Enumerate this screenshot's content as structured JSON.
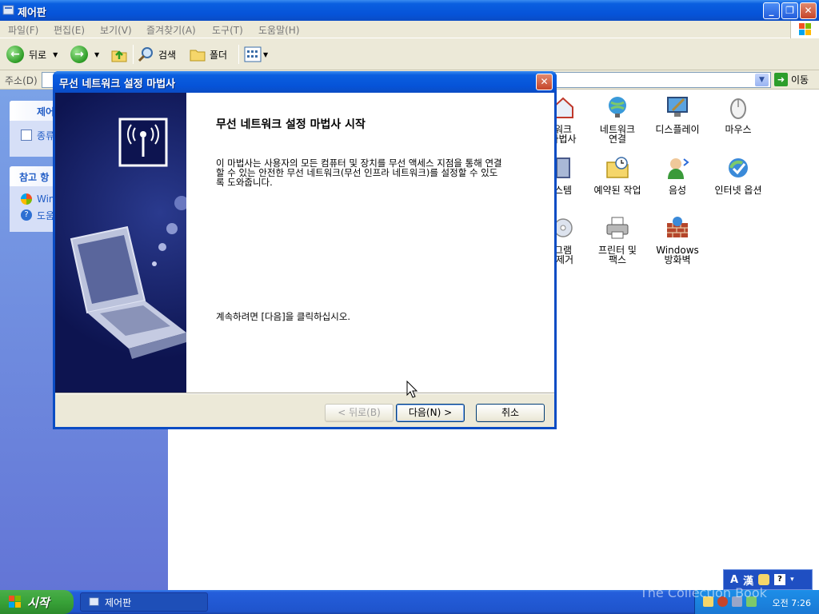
{
  "window": {
    "title": "제어판",
    "buttons": {
      "minimize": "_",
      "maximize": "❐",
      "close": "✕"
    }
  },
  "menubar": [
    "파일(F)",
    "편집(E)",
    "보기(V)",
    "즐겨찾기(A)",
    "도구(T)",
    "도움말(H)"
  ],
  "toolbar": {
    "back": "뒤로",
    "search": "검색",
    "folders": "폴더"
  },
  "addressbar": {
    "label": "주소(D)",
    "go": "이동"
  },
  "leftpane": {
    "panel1_title": "제어",
    "panel1_item": "종류",
    "panel2_title": "참고 항",
    "panel2_items": [
      "Win",
      "도움"
    ]
  },
  "content": {
    "icons": [
      {
        "name": "워크\n마법사",
        "icon": "network-wizard-icon"
      },
      {
        "name": "네트워크\n연결",
        "icon": "network-connections-icon"
      },
      {
        "name": "디스플레이",
        "icon": "display-icon"
      },
      {
        "name": "마우스",
        "icon": "mouse-icon"
      },
      {
        "name": "스템",
        "icon": "system-icon"
      },
      {
        "name": "예약된 작업",
        "icon": "scheduled-tasks-icon"
      },
      {
        "name": "음성",
        "icon": "speech-icon"
      },
      {
        "name": "인터넷 옵션",
        "icon": "internet-options-icon"
      },
      {
        "name": "그램\n/제거",
        "icon": "add-remove-programs-icon"
      },
      {
        "name": "프린터 및\n팩스",
        "icon": "printers-icon"
      },
      {
        "name": "Windows\n방화벽",
        "icon": "firewall-icon"
      }
    ]
  },
  "dialog": {
    "title": "무선 네트워크 설정 마법사",
    "heading": "무선 네트워크 설정 마법사 시작",
    "description": "이 마법사는 사용자의 모든 컴퓨터 및 장치를 무선 액세스 지점을 통해 연결할 수 있는 안전한 무선 네트워크(무선 인프라 네트워크)를 설정할 수 있도록 도와줍니다.",
    "continue_text": "계속하려면 [다음]을 클릭하십시오.",
    "back_button": "< 뒤로(B)",
    "next_button": "다음(N) >",
    "cancel_button": "취소"
  },
  "taskbar": {
    "start": "시작",
    "task": "제어판",
    "clock": "오전 7:26",
    "langbar": [
      "A",
      "漢"
    ],
    "watermark": "The Collection Book"
  }
}
